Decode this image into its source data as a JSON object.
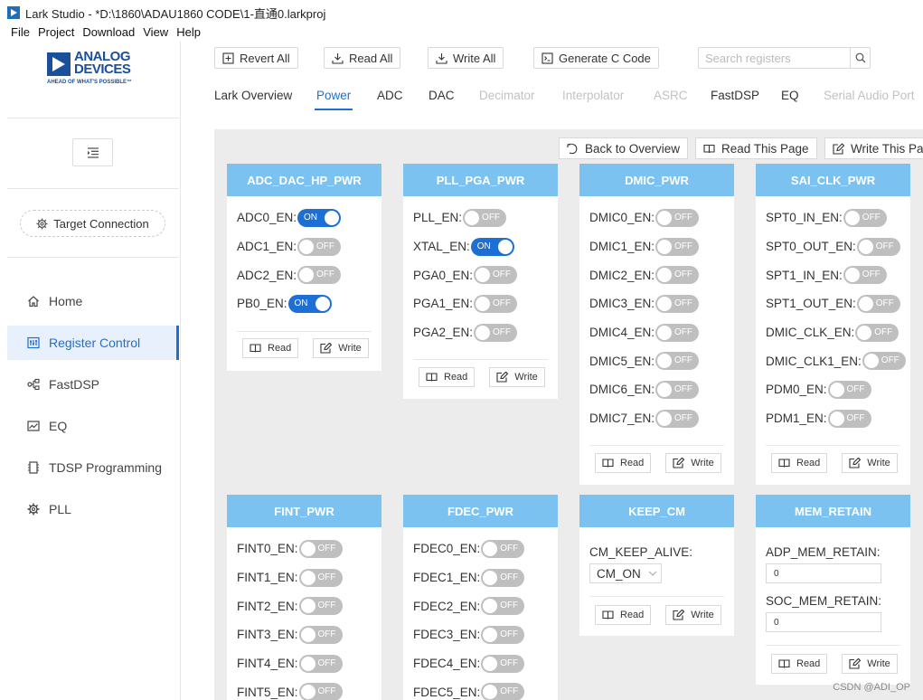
{
  "window": {
    "title": "Lark Studio - *D:\\1860\\ADAU1860 CODE\\1-直通0.larkproj"
  },
  "menu": [
    "File",
    "Project",
    "Download",
    "View",
    "Help"
  ],
  "brand": {
    "name_line1": "ANALOG",
    "name_line2": "DEVICES",
    "tagline": "AHEAD OF WHAT'S POSSIBLE™",
    "color": "#1a4f9c"
  },
  "sidebar": {
    "target_connection": "Target Connection",
    "items": [
      {
        "label": "Home",
        "icon": "home-icon",
        "active": false
      },
      {
        "label": "Register Control",
        "icon": "register-control-icon",
        "active": true
      },
      {
        "label": "FastDSP",
        "icon": "fastdsp-icon",
        "active": false
      },
      {
        "label": "EQ",
        "icon": "eq-icon",
        "active": false
      },
      {
        "label": "TDSP Programming",
        "icon": "tdsp-icon",
        "active": false
      },
      {
        "label": "PLL",
        "icon": "pll-gear-icon",
        "active": false
      }
    ]
  },
  "toolbar": {
    "revert_all": "Revert All",
    "read_all": "Read All",
    "write_all": "Write All",
    "generate_c": "Generate C Code",
    "search_placeholder": "Search registers"
  },
  "tabs": [
    {
      "label": "Lark Overview",
      "state": "normal"
    },
    {
      "label": "Power",
      "state": "active"
    },
    {
      "label": "ADC",
      "state": "normal"
    },
    {
      "label": "DAC",
      "state": "normal"
    },
    {
      "label": "Decimator",
      "state": "disabled"
    },
    {
      "label": "Interpolator",
      "state": "disabled"
    },
    {
      "label": "ASRC",
      "state": "disabled"
    },
    {
      "label": "FastDSP",
      "state": "normal"
    },
    {
      "label": "EQ",
      "state": "normal"
    },
    {
      "label": "Serial Audio Port",
      "state": "disabled"
    }
  ],
  "page_actions": {
    "back": "Back to Overview",
    "read_page": "Read This Page",
    "write_page": "Write This Pa"
  },
  "switch_text": {
    "on": "ON",
    "off": "OFF"
  },
  "card_buttons": {
    "read": "Read",
    "write": "Write"
  },
  "cards": {
    "adc_dac_hp_pwr": {
      "title": "ADC_DAC_HP_PWR",
      "fields": [
        {
          "label": "ADC0_EN:",
          "on": true
        },
        {
          "label": "ADC1_EN:",
          "on": false
        },
        {
          "label": "ADC2_EN:",
          "on": false
        },
        {
          "label": "PB0_EN:",
          "on": true
        }
      ]
    },
    "pll_pga_pwr": {
      "title": "PLL_PGA_PWR",
      "fields": [
        {
          "label": "PLL_EN:",
          "on": false
        },
        {
          "label": "XTAL_EN:",
          "on": true
        },
        {
          "label": "PGA0_EN:",
          "on": false
        },
        {
          "label": "PGA1_EN:",
          "on": false
        },
        {
          "label": "PGA2_EN:",
          "on": false
        }
      ]
    },
    "dmic_pwr": {
      "title": "DMIC_PWR",
      "fields": [
        {
          "label": "DMIC0_EN:",
          "on": false
        },
        {
          "label": "DMIC1_EN:",
          "on": false
        },
        {
          "label": "DMIC2_EN:",
          "on": false
        },
        {
          "label": "DMIC3_EN:",
          "on": false
        },
        {
          "label": "DMIC4_EN:",
          "on": false
        },
        {
          "label": "DMIC5_EN:",
          "on": false
        },
        {
          "label": "DMIC6_EN:",
          "on": false
        },
        {
          "label": "DMIC7_EN:",
          "on": false
        }
      ]
    },
    "sai_clk_pwr": {
      "title": "SAI_CLK_PWR",
      "fields": [
        {
          "label": "SPT0_IN_EN:",
          "on": false
        },
        {
          "label": "SPT0_OUT_EN:",
          "on": false
        },
        {
          "label": "SPT1_IN_EN:",
          "on": false
        },
        {
          "label": "SPT1_OUT_EN:",
          "on": false
        },
        {
          "label": "DMIC_CLK_EN:",
          "on": false
        },
        {
          "label": "DMIC_CLK1_EN:",
          "on": false
        },
        {
          "label": "PDM0_EN:",
          "on": false
        },
        {
          "label": "PDM1_EN:",
          "on": false
        }
      ]
    },
    "fint_pwr": {
      "title": "FINT_PWR",
      "fields": [
        {
          "label": "FINT0_EN:",
          "on": false
        },
        {
          "label": "FINT1_EN:",
          "on": false
        },
        {
          "label": "FINT2_EN:",
          "on": false
        },
        {
          "label": "FINT3_EN:",
          "on": false
        },
        {
          "label": "FINT4_EN:",
          "on": false
        },
        {
          "label": "FINT5_EN:",
          "on": false
        }
      ]
    },
    "fdec_pwr": {
      "title": "FDEC_PWR",
      "fields": [
        {
          "label": "FDEC0_EN:",
          "on": false
        },
        {
          "label": "FDEC1_EN:",
          "on": false
        },
        {
          "label": "FDEC2_EN:",
          "on": false
        },
        {
          "label": "FDEC3_EN:",
          "on": false
        },
        {
          "label": "FDEC4_EN:",
          "on": false
        },
        {
          "label": "FDEC5_EN:",
          "on": false
        }
      ]
    },
    "keep_cm": {
      "title": "KEEP_CM",
      "label": "CM_KEEP_ALIVE:",
      "value": "CM_ON"
    },
    "mem_retain": {
      "title": "MEM_RETAIN",
      "adp_label": "ADP_MEM_RETAIN:",
      "adp_value": "0",
      "soc_label": "SOC_MEM_RETAIN:",
      "soc_value": "0"
    }
  },
  "colors": {
    "accent": "#1d6fd6",
    "card_header": "#7cc2f0",
    "content_bg": "#ececec",
    "switch_off": "#bfbfbf"
  },
  "watermark": "CSDN @ADI_OP"
}
